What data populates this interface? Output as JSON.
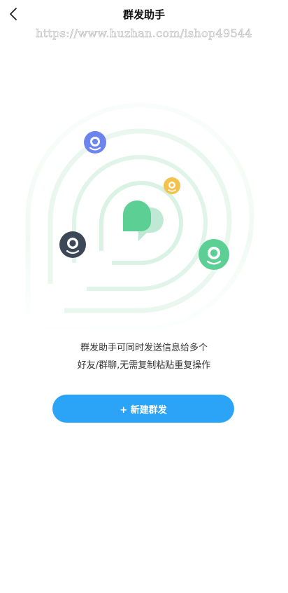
{
  "header": {
    "title": "群发助手",
    "back_icon": "chevron-left-icon"
  },
  "watermark": {
    "text": "https://www.huzhan.com/ishop49544"
  },
  "illustration": {
    "center_icon": "chat-bubble-icon",
    "avatars": [
      "avatar-icon",
      "avatar-icon",
      "avatar-icon",
      "avatar-icon"
    ],
    "colors": {
      "purple": "#6b84ee",
      "yellow": "#f2c24c",
      "dark": "#3c4758",
      "green": "#5ccf94",
      "ring": "#e6f7ee"
    }
  },
  "main": {
    "description_line1": "群发助手可同时发送信息给多个",
    "description_line2": "好友/群聊,无需复制粘贴重复操作"
  },
  "actions": {
    "new_group_label": "+ 新建群发"
  },
  "colors": {
    "accent": "#2ba4f7"
  }
}
